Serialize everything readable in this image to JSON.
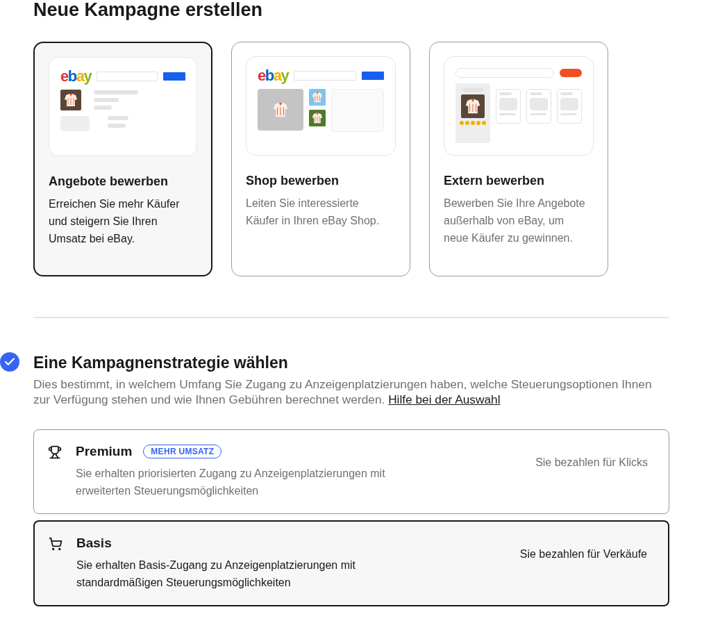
{
  "title": "Neue Kampagne erstellen",
  "campaign_types": [
    {
      "kind": "listings",
      "logo": "ebay",
      "selected": true,
      "title": "Angebote bewerben",
      "description": "Erreichen Sie mehr Käufer und steigern Sie Ihren Umsatz bei eBay."
    },
    {
      "kind": "shop",
      "logo": "ebay",
      "selected": false,
      "title": "Shop bewerben",
      "description": "Leiten Sie interessierte Käufer in Ihren eBay Shop."
    },
    {
      "kind": "external",
      "selected": false,
      "title": "Extern bewerben",
      "description": "Bewerben Sie Ihre Angebote außerhalb von eBay, um neue Käufer zu gewinnen."
    }
  ],
  "strategy": {
    "completed": true,
    "title": "Eine Kampagnenstrategie wählen",
    "description": "Dies bestimmt, in welchem Umfang Sie Zugang zu Anzeigenplatzierungen haben, welche Steuerungsoptionen Ihnen zur Verfügung stehen und wie Ihnen Gebühren berechnet werden.",
    "help_link": "Hilfe bei der Auswahl",
    "options": [
      {
        "name": "Premium",
        "badge": "MEHR UMSATZ",
        "selected": false,
        "description": "Sie erhalten priorisierten Zugang zu Anzeigenplatzierungen mit erweiterten Steuerungsmöglichkeiten",
        "pricing": "Sie bezahlen für Klicks"
      },
      {
        "name": "Basis",
        "selected": true,
        "description": "Sie erhalten Basis-Zugang zu Anzeigenplatzierungen mit standardmäßigen Steuerungsmöglichkeiten",
        "pricing": "Sie bezahlen für Verkäufe"
      }
    ]
  }
}
